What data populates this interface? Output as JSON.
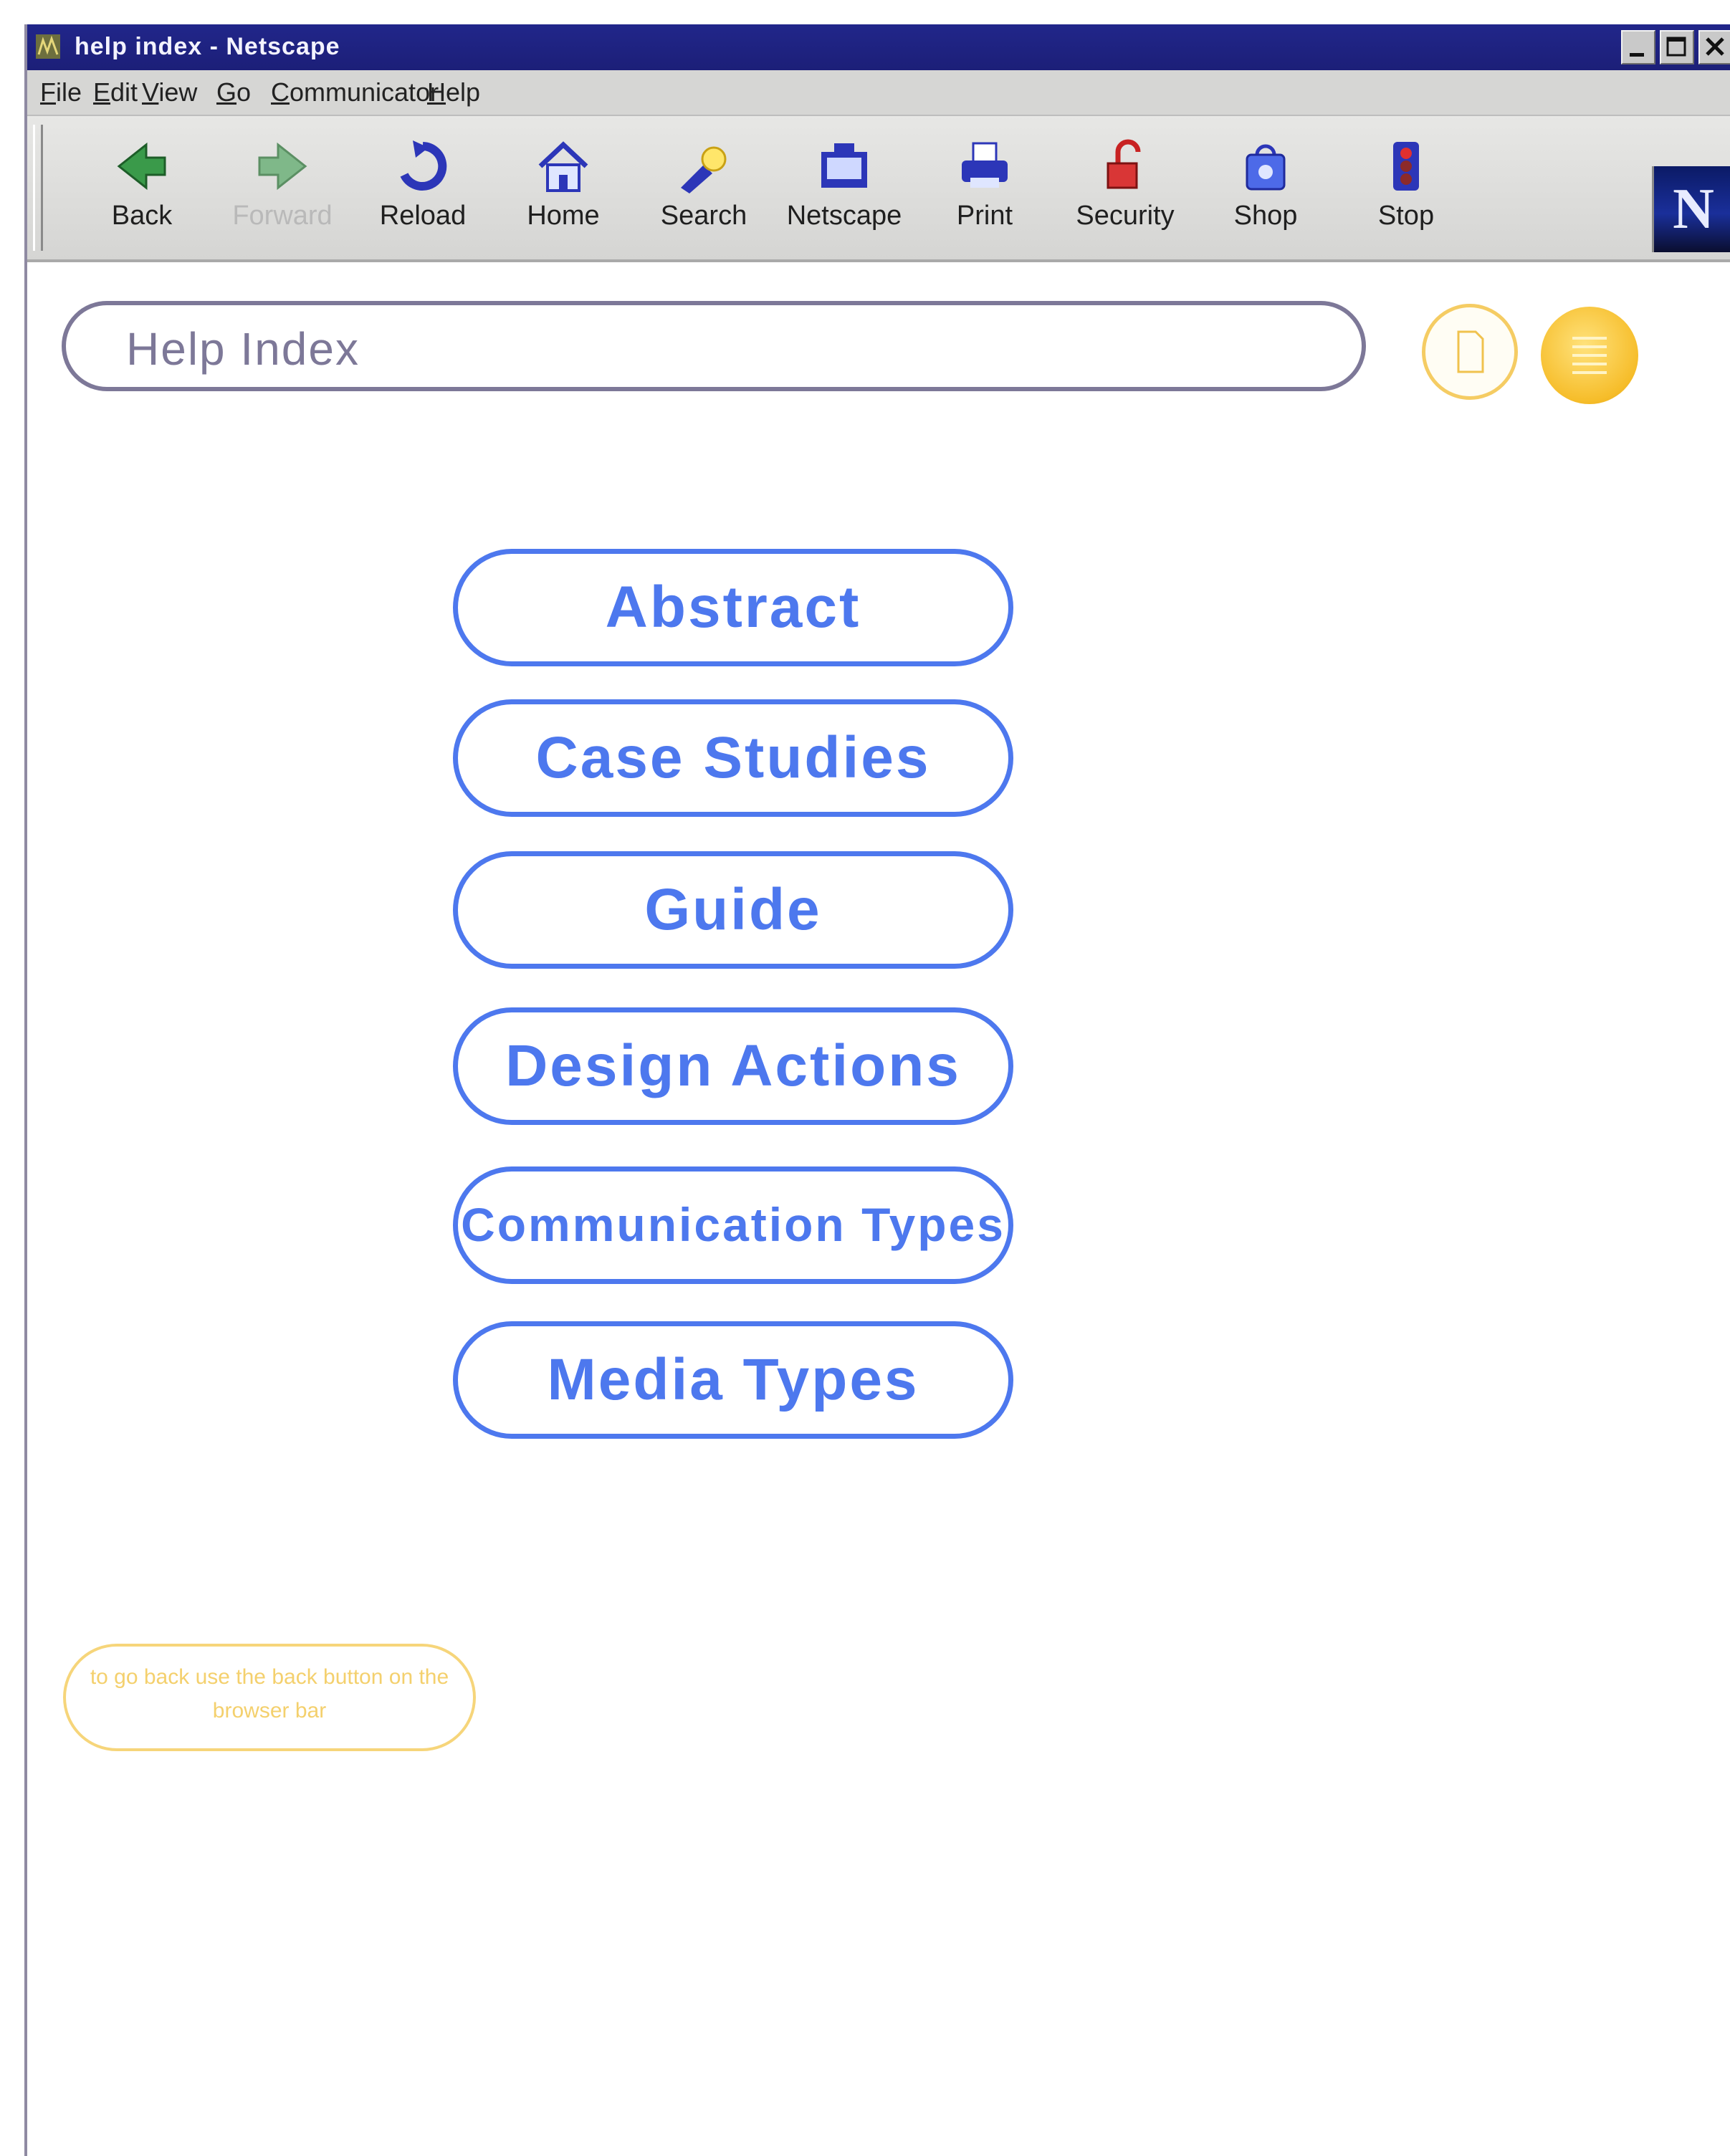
{
  "window": {
    "title": "help index - Netscape"
  },
  "menubar": {
    "items": [
      "File",
      "Edit",
      "View",
      "Go",
      "Communicator",
      "Help"
    ]
  },
  "toolbar": {
    "buttons": [
      {
        "label": "Back",
        "icon": "back-arrow-icon"
      },
      {
        "label": "Forward",
        "icon": "forward-arrow-icon",
        "disabled": true
      },
      {
        "label": "Reload",
        "icon": "reload-icon"
      },
      {
        "label": "Home",
        "icon": "home-icon"
      },
      {
        "label": "Search",
        "icon": "search-icon"
      },
      {
        "label": "Netscape",
        "icon": "netscape-icon"
      },
      {
        "label": "Print",
        "icon": "print-icon"
      },
      {
        "label": "Security",
        "icon": "security-lock-icon"
      },
      {
        "label": "Shop",
        "icon": "shop-bag-icon"
      },
      {
        "label": "Stop",
        "icon": "stop-icon"
      }
    ],
    "logo": "N"
  },
  "page": {
    "title": "Help Index",
    "nav_buttons": [
      "Abstract",
      "Case Studies",
      "Guide",
      "Design Actions",
      "Communication Types",
      "Media Types"
    ],
    "hint": "to go back use the back button on the browser bar"
  },
  "colors": {
    "titlebar": "#21268a",
    "nav_blue": "#4d78ee",
    "pill_gray": "#7d7898",
    "accent_yellow": "#f6bd2a"
  }
}
